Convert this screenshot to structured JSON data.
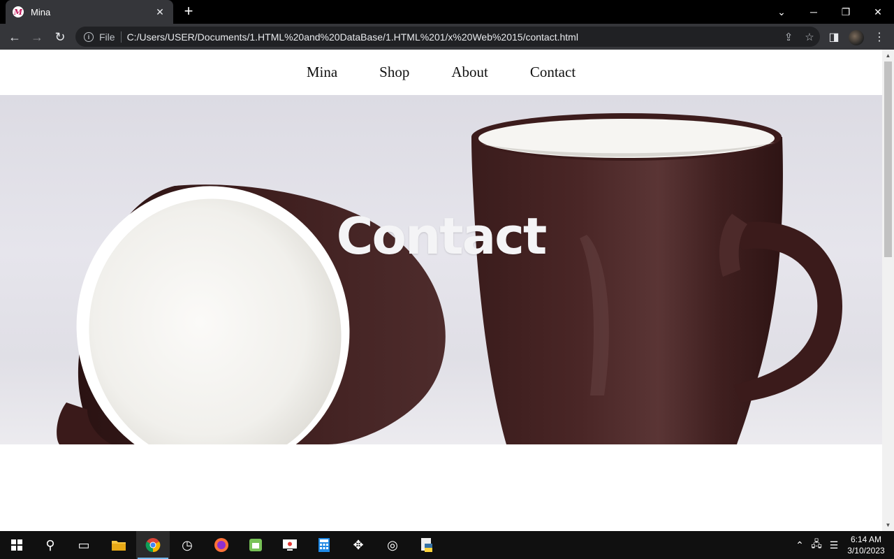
{
  "browser": {
    "tab": {
      "title": "Mina",
      "favicon_letter": "M"
    },
    "new_tab_symbol": "+",
    "address": {
      "scheme_label": "File",
      "url": "C:/Users/USER/Documents/1.HTML%20and%20DataBase/1.HTML%201/x%20Web%2015/contact.html"
    }
  },
  "page": {
    "nav": [
      "Mina",
      "Shop",
      "About",
      "Contact"
    ],
    "hero_title": "Contact"
  },
  "taskbar": {
    "time": "6:14 AM",
    "date": "3/10/2023"
  },
  "colors": {
    "mug_brown": "#3e1e1e",
    "mug_inner": "#f5f4f1",
    "hero_background": "#e2e1e8"
  }
}
